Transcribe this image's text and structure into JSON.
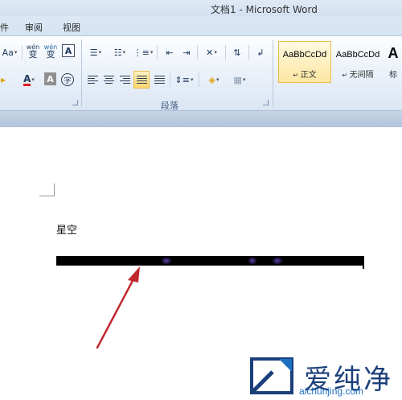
{
  "window": {
    "title": "文档1 - Microsoft Word"
  },
  "tabs": [
    "件",
    "审阅",
    "视图"
  ],
  "ribbon": {
    "font_group": {
      "change_case": "Aa",
      "phonetic": "wén",
      "phonetic_sub": "变",
      "border_char": "A",
      "font_color_letter": "A",
      "shade_char": "A",
      "enclose_char": "字"
    },
    "paragraph_group": {
      "label": "段落"
    },
    "styles": [
      {
        "sample": "AaBbCcDd",
        "name": "正文",
        "selected": true
      },
      {
        "sample": "AaBbCcDd",
        "name": "无间隔",
        "selected": false
      },
      {
        "sample": "A",
        "name": "标",
        "selected": false
      }
    ]
  },
  "document": {
    "text": "星空"
  },
  "watermark": {
    "brand": "爱纯净",
    "url": "aichunjing.com"
  },
  "colors": {
    "arrow": "#c0282d",
    "line_glow": "#5a2dbf",
    "accent_selected": "#fde6a2"
  }
}
